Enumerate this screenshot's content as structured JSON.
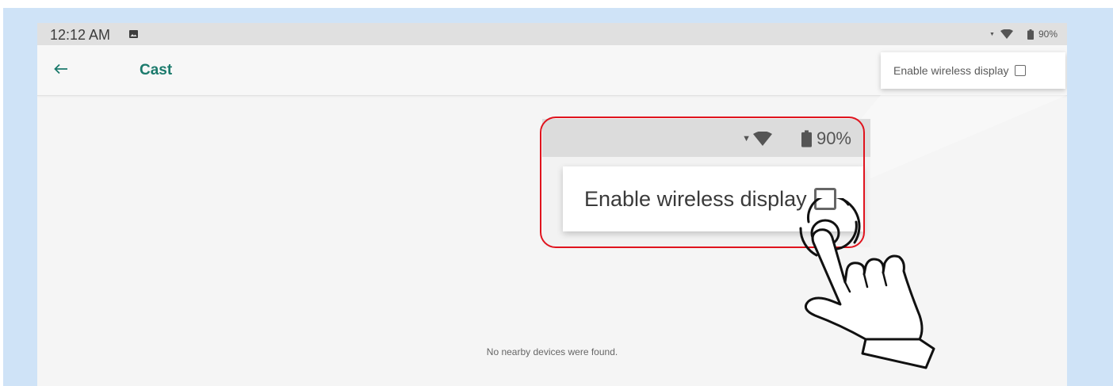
{
  "statusbar": {
    "time": "12:12 AM",
    "battery": "90%",
    "icons": [
      "gallery-icon",
      "signal-icon",
      "wifi-icon",
      "battery-icon"
    ]
  },
  "appbar": {
    "back_icon": "back-arrow-icon",
    "title": "Cast"
  },
  "menu": {
    "enable_wireless_display_label": "Enable wireless display",
    "enable_wireless_display_checked": false
  },
  "main": {
    "empty_message": "No nearby devices were found."
  },
  "zoom_callout": {
    "battery": "90%",
    "label": "Enable wireless display",
    "checked": false,
    "pointer_icon": "tapping-hand-icon"
  },
  "colors": {
    "accent": "#1b7a6c",
    "highlight_frame": "#e0141e",
    "background": "#cfe3f7"
  }
}
